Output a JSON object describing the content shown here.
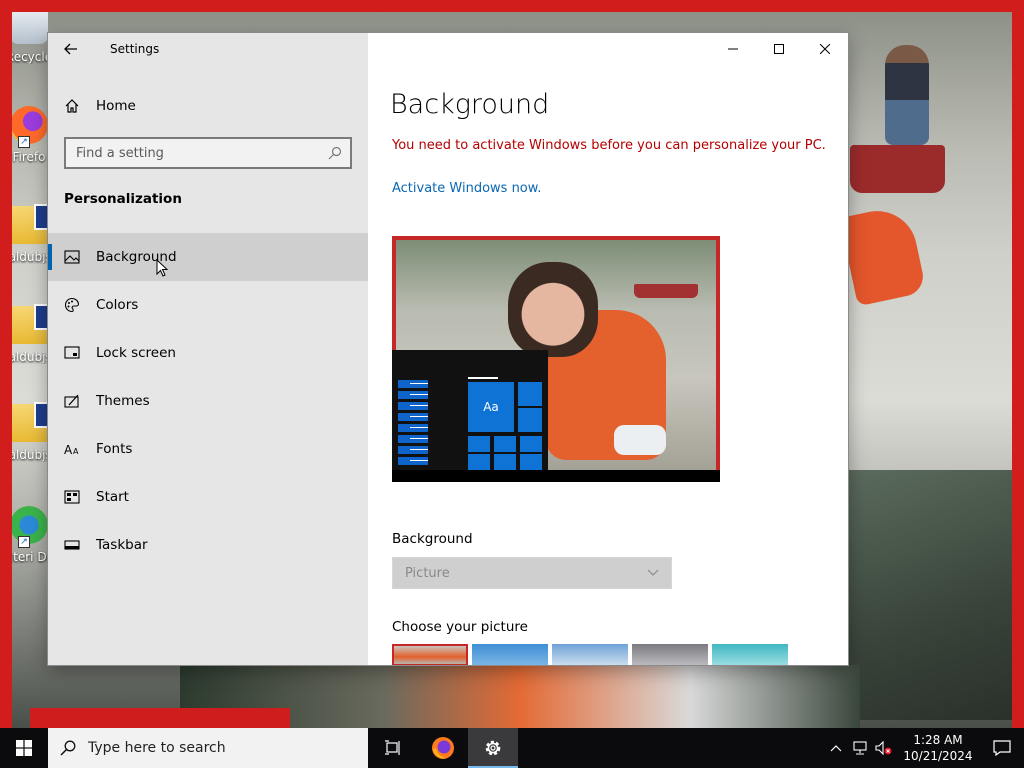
{
  "desktop": {
    "icons": [
      {
        "label": "Recycle",
        "icon": "recycle-bin-icon"
      },
      {
        "label": "Firefo",
        "icon": "firefox-icon"
      },
      {
        "label": "caldubjs-",
        "icon": "folder-icon"
      },
      {
        "label": "caldubjs-",
        "icon": "folder-icon"
      },
      {
        "label": "caldubjs-",
        "icon": "folder-icon"
      },
      {
        "label": "Interi Downl",
        "icon": "internet-download-manager-icon"
      }
    ]
  },
  "window": {
    "title": "Settings",
    "sidebar": {
      "home_label": "Home",
      "search_placeholder": "Find a setting",
      "section_heading": "Personalization",
      "items": [
        {
          "label": "Background",
          "icon": "picture-icon",
          "selected": true
        },
        {
          "label": "Colors",
          "icon": "palette-icon",
          "selected": false
        },
        {
          "label": "Lock screen",
          "icon": "lock-screen-icon",
          "selected": false
        },
        {
          "label": "Themes",
          "icon": "themes-icon",
          "selected": false
        },
        {
          "label": "Fonts",
          "icon": "fonts-icon",
          "selected": false
        },
        {
          "label": "Start",
          "icon": "start-icon",
          "selected": false
        },
        {
          "label": "Taskbar",
          "icon": "taskbar-icon",
          "selected": false
        }
      ]
    },
    "content": {
      "page_title": "Background",
      "activation_warning": "You need to activate Windows before you can personalize your PC.",
      "activation_link": "Activate Windows now.",
      "preview_tile_text": "Aa",
      "background_label": "Background",
      "background_value": "Picture",
      "choose_picture_label": "Choose your picture"
    }
  },
  "taskbar": {
    "search_placeholder": "Type here to search",
    "time": "1:28 AM",
    "date": "10/21/2024"
  },
  "colors": {
    "accent": "#0078d7",
    "warning": "#b50000",
    "link": "#0a67b3",
    "desktop_border": "#d21d1d"
  }
}
